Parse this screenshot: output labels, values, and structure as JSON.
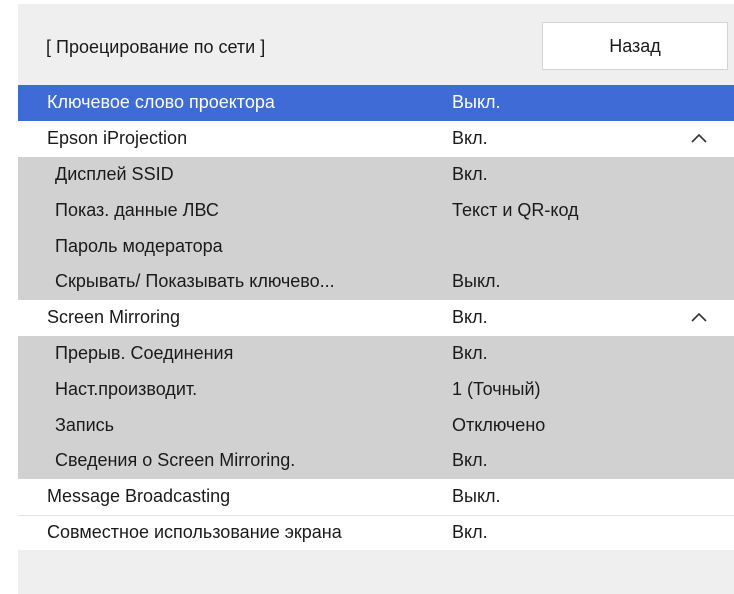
{
  "header": {
    "title": "[ Проецирование по сети ]",
    "back_label": "Назад"
  },
  "rows": [
    {
      "label": "Ключевое слово проектора",
      "value": "Выкл.",
      "kind": "selected"
    },
    {
      "label": "Epson iProjection",
      "value": "Вкл.",
      "kind": "top",
      "icon": "chevron-up-icon"
    },
    {
      "label": "Дисплей SSID",
      "value": "Вкл.",
      "kind": "sub"
    },
    {
      "label": "Показ. данные ЛВС",
      "value": "Текст и QR-код",
      "kind": "sub"
    },
    {
      "label": "Пароль модератора",
      "value": "",
      "kind": "sub"
    },
    {
      "label": "Скрывать/ Показывать ключево...",
      "value": "Выкл.",
      "kind": "sub"
    },
    {
      "label": "Screen Mirroring",
      "value": "Вкл.",
      "kind": "top",
      "icon": "chevron-up-icon"
    },
    {
      "label": "Прерыв. Соединения",
      "value": "Вкл.",
      "kind": "sub"
    },
    {
      "label": "Наст.производит.",
      "value": "1 (Точный)",
      "kind": "sub"
    },
    {
      "label": "Запись",
      "value": "Отключено",
      "kind": "sub"
    },
    {
      "label": "Сведения о Screen Mirroring.",
      "value": "Вкл.",
      "kind": "sub"
    },
    {
      "label": "Message Broadcasting",
      "value": "Выкл.",
      "kind": "top"
    },
    {
      "label": "Совместное использование экрана",
      "value": "Вкл.",
      "kind": "top"
    }
  ],
  "colors": {
    "selected": "#3f6bd6",
    "panel": "#efefef",
    "sub_row": "#d1d1d1",
    "top_row": "#ffffff"
  }
}
